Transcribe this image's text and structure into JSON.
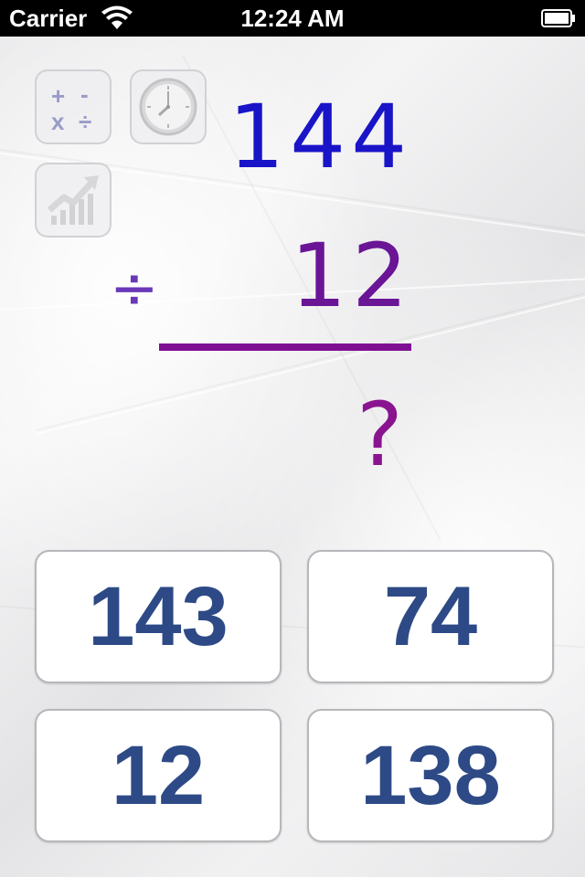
{
  "status_bar": {
    "carrier": "Carrier",
    "time": "12:24 AM"
  },
  "toolbar": {
    "operations_icon": {
      "glyphs": [
        "+",
        "-",
        "x",
        "÷"
      ]
    },
    "clock_icon": "clock-icon",
    "stats_icon": "stats-chart-icon"
  },
  "problem": {
    "top_number": "144",
    "operator": "÷",
    "second_number": "12",
    "answer_placeholder": "?"
  },
  "choices": [
    {
      "label": "143"
    },
    {
      "label": "74"
    },
    {
      "label": "12"
    },
    {
      "label": "138"
    }
  ],
  "colors": {
    "top_number": "#1a14c8",
    "second_number": "#6a1496",
    "operator": "#6a38b8",
    "answer_line": "#7e0f93",
    "answer_mark": "#8a148f",
    "choice_text": "#2d4a86"
  }
}
